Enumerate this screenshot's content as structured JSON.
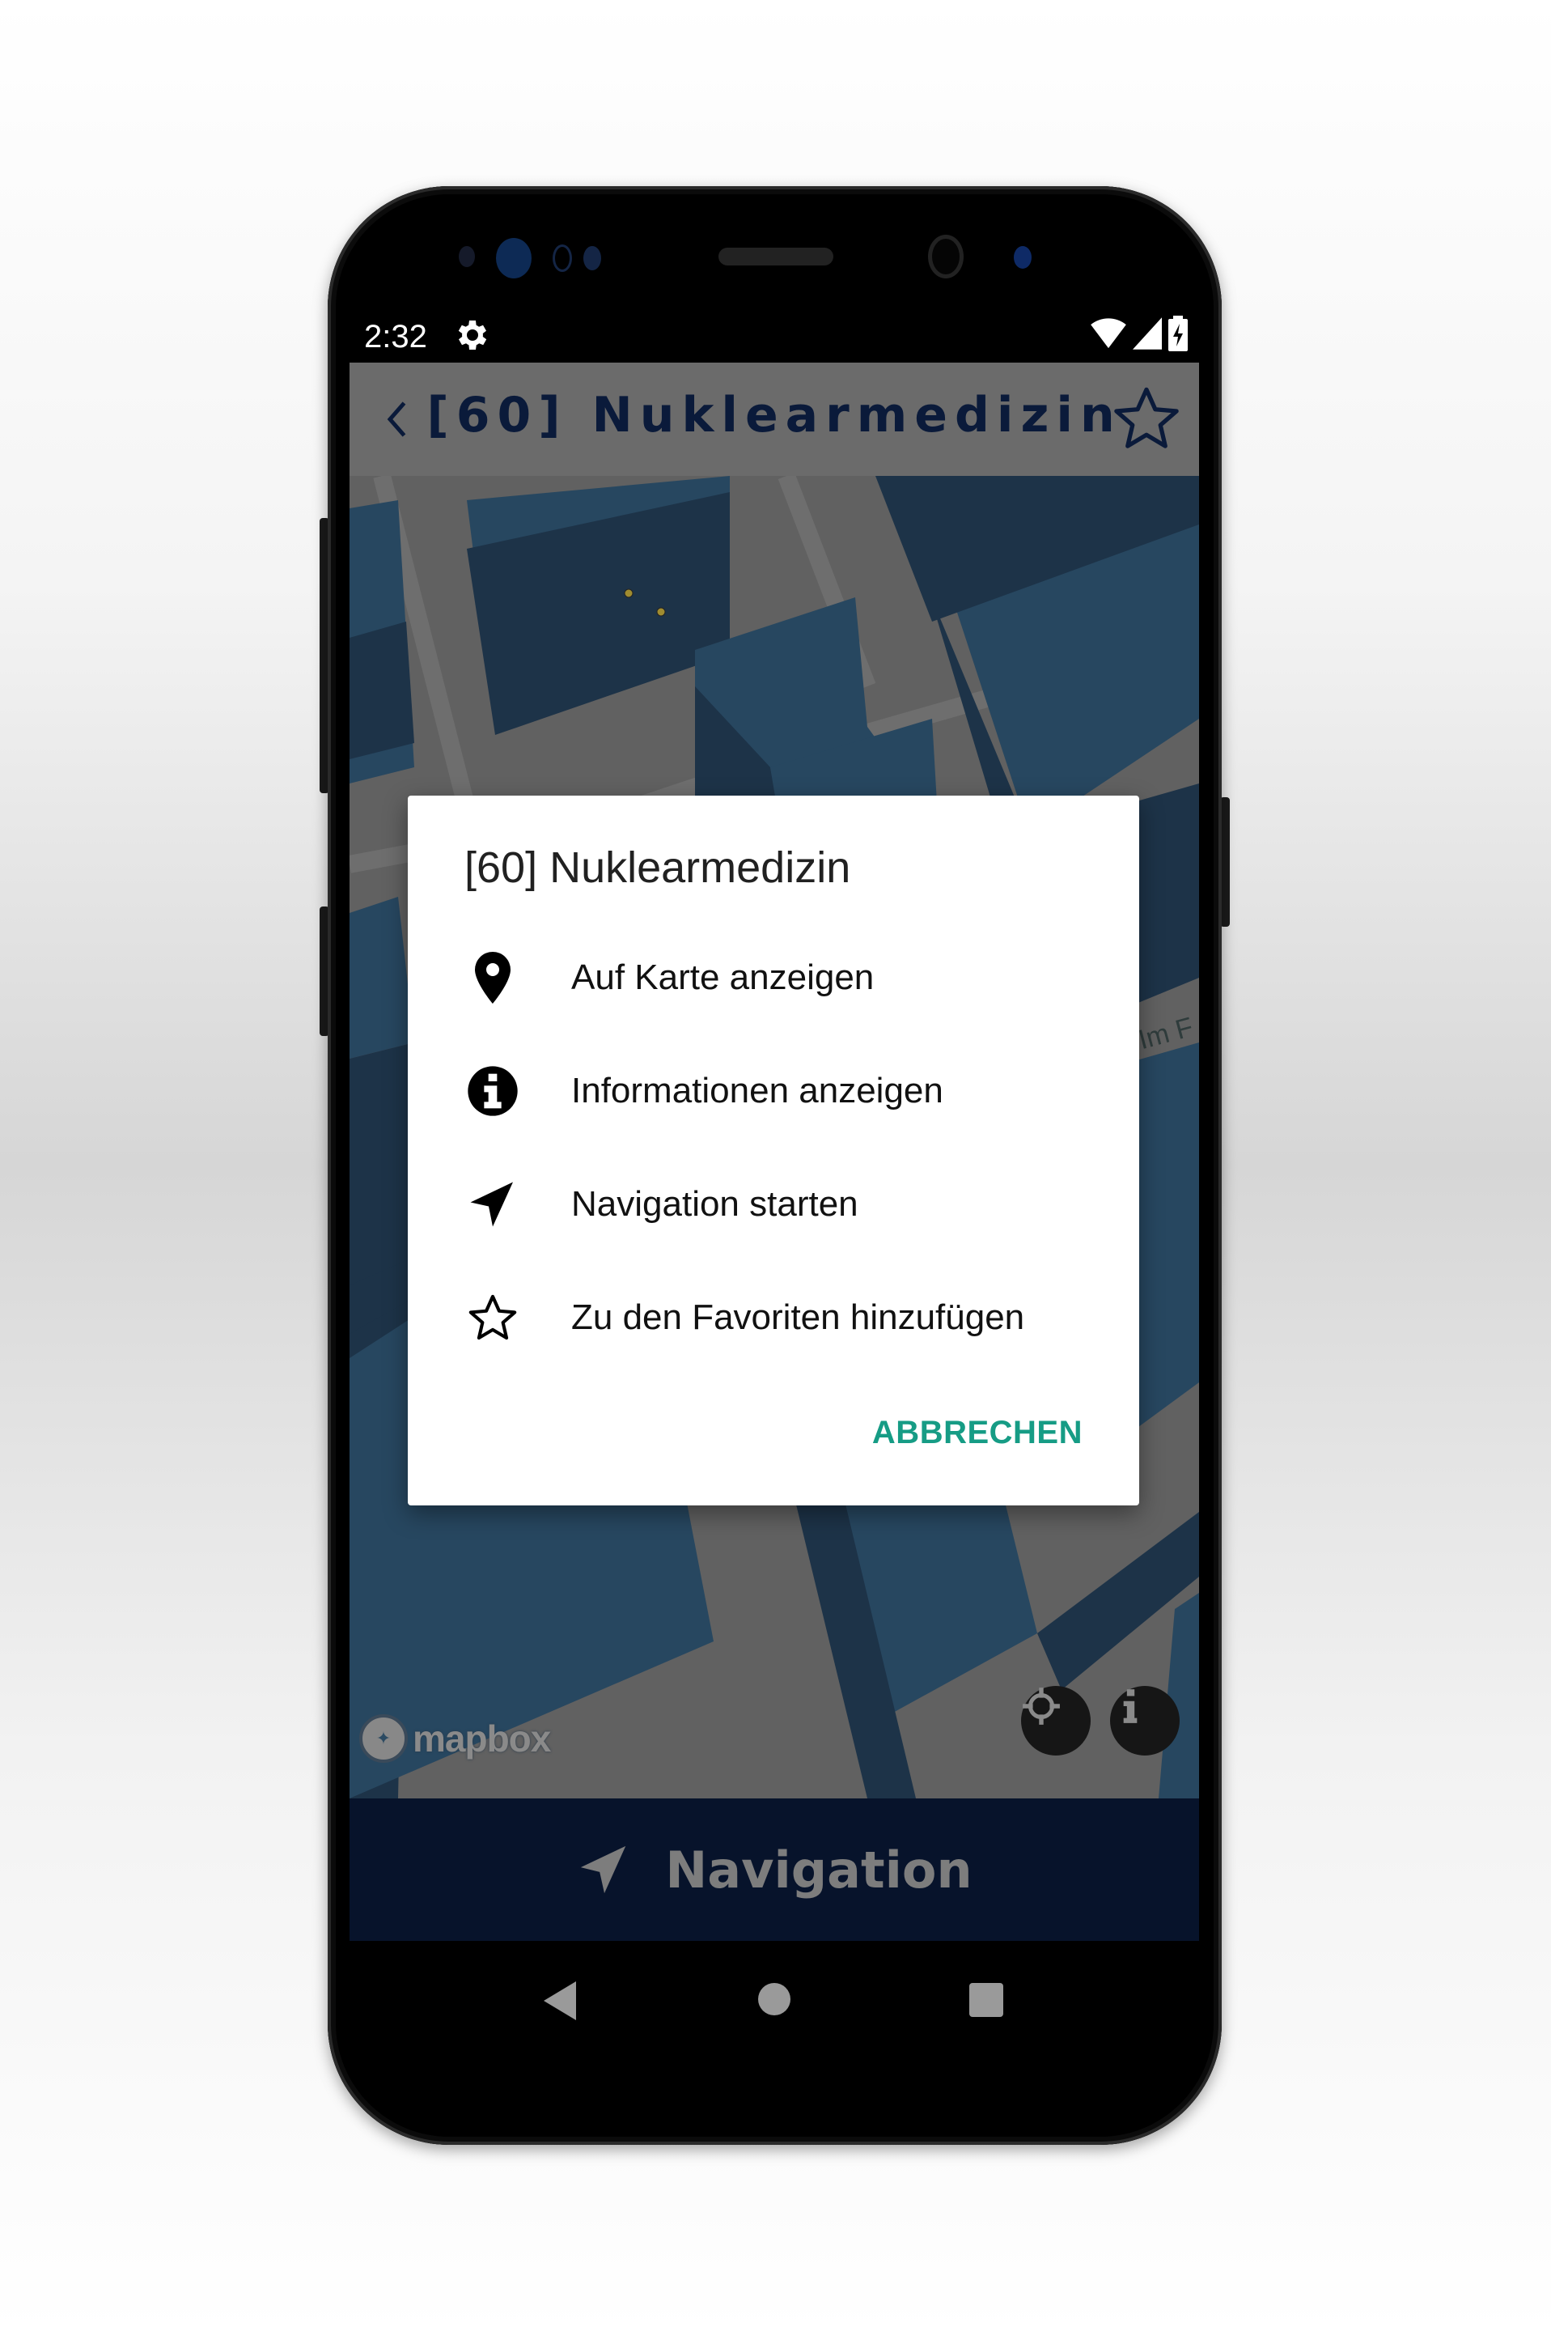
{
  "status_bar": {
    "time": "2:32",
    "icons": [
      "settings-gear-icon",
      "wifi-icon",
      "cell-signal-icon",
      "battery-charging-icon"
    ]
  },
  "app_bar": {
    "back_icon": "chevron-left-icon",
    "title": "[60] Nuklearmedizin",
    "favorite_icon": "star-outline-icon"
  },
  "map": {
    "partial_street_label": "Im F",
    "attribution": "mapbox",
    "buttons": [
      {
        "name": "locate-button",
        "icon": "crosshair-icon"
      },
      {
        "name": "map-info-button",
        "icon": "info-icon"
      }
    ]
  },
  "bottom_button": {
    "icon": "navigation-arrow-icon",
    "label": "Navigation"
  },
  "dialog": {
    "title": "[60] Nuklearmedizin",
    "items": [
      {
        "icon": "map-pin-icon",
        "label": "Auf Karte anzeigen"
      },
      {
        "icon": "info-circle-icon",
        "label": "Informationen anzeigen"
      },
      {
        "icon": "navigation-arrow-icon",
        "label": "Navigation starten"
      },
      {
        "icon": "star-outline-icon",
        "label": "Zu den Favoriten hinzufügen"
      }
    ],
    "cancel_label": "ABBRECHEN",
    "accent_color": "#169c85"
  },
  "system_nav": {
    "back": "nav-back-icon",
    "home": "nav-home-icon",
    "recents": "nav-recents-icon"
  },
  "colors": {
    "app_bar_dimmed": "#6b6b6b",
    "title_color": "#0a1a3a",
    "building_dimmed": "#274760",
    "bottom_bar": "#07132b"
  }
}
